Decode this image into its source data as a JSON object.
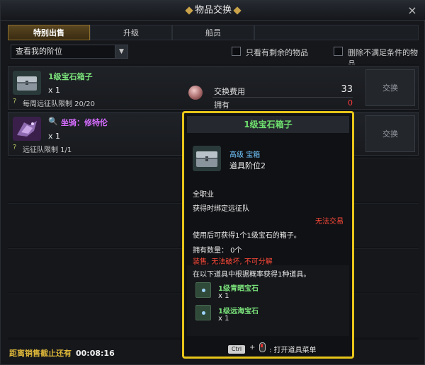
{
  "window": {
    "title": "物品交换",
    "close_label": "×"
  },
  "tabs": [
    {
      "label": "特别出售",
      "active": true
    },
    {
      "label": "升级",
      "active": false
    },
    {
      "label": "船员",
      "active": false
    }
  ],
  "filter": {
    "select_value": "查看我的阶位",
    "check_remaining_label": "只看有剩余的物品",
    "check_unmet_label": "删除不满足条件的物品"
  },
  "items": [
    {
      "name": "1级宝石箱子",
      "name_color": "#7be37b",
      "qty": "x 1",
      "limit": "每周远征队限制 20/20",
      "exchange_label": "交换",
      "cost_label": "交换费用",
      "cost_value": "33",
      "own_label": "拥有",
      "own_value": "0"
    },
    {
      "name": "坐骑：修特伦",
      "name_color": "#d56cff",
      "qty": "x 1",
      "limit": "远征队限制 1/1",
      "exchange_label": "交换"
    }
  ],
  "footer": {
    "label": "距离销售截止还有",
    "time": "00:08:16"
  },
  "tooltip": {
    "title": "1级宝石箱子",
    "grade": "高级 宝箱",
    "slot": "道具阶位2",
    "class_req": "全职业",
    "bind": "获得时绑定远征队",
    "untradeable": "无法交易",
    "desc": "使用后可获得1个1级宝石的箱子。",
    "owned": "拥有数量： 0个",
    "restrictions": "装售, 无法破坏, 不可分解",
    "box_header": "在以下道具中根据概率获得1种道具。",
    "rewards": [
      {
        "name": "1级青晒宝石",
        "qty": "x 1"
      },
      {
        "name": "1级远海宝石",
        "qty": "x 1"
      }
    ],
    "key_ctrl": "Ctrl",
    "key_plus": "+",
    "key_text": ": 打开道具菜单"
  },
  "colors": {
    "accent_gold": "#e7c51a",
    "uncommon_green": "#7be37b",
    "epic_purple": "#d56cff",
    "warning_red": "#ff4a3a"
  },
  "icons": [
    "close-icon",
    "chevron-down-icon",
    "treasure-chest-icon",
    "mount-icon",
    "magnifier-icon",
    "coin-icon",
    "gem-icon",
    "mouse-right-icon"
  ]
}
